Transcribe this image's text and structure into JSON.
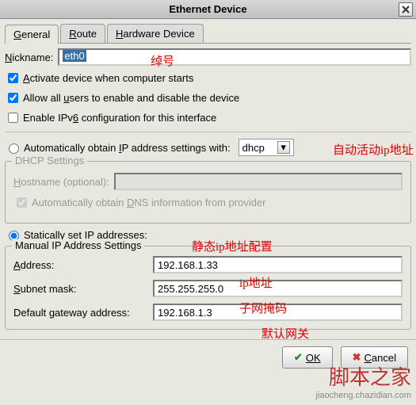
{
  "window": {
    "title": "Ethernet Device"
  },
  "tabs": {
    "general_u": "G",
    "general_rest": "eneral",
    "route_u": "R",
    "route_rest": "oute",
    "hw_u": "H",
    "hw_rest": "ardware Device"
  },
  "nickname": {
    "label_u": "N",
    "label_rest": "ickname:",
    "value": "eth0"
  },
  "checks": {
    "activate_pre": "",
    "activate_u": "A",
    "activate_rest": "ctivate device when computer starts",
    "users_pre": "Allow all ",
    "users_u": "u",
    "users_rest": "sers to enable and disable the device",
    "ipv6_pre": "Enable IPv",
    "ipv6_u": "6",
    "ipv6_rest": " configuration for this interface"
  },
  "auto": {
    "label_pre": "Automatically obtain ",
    "label_u": "I",
    "label_rest": "P address settings with:",
    "dd_value": "dhcp"
  },
  "dhcp": {
    "legend": "DHCP Settings",
    "hostname_pre": "",
    "hostname_u": "H",
    "hostname_rest": "ostname (optional):",
    "autodns_pre": "Automatically obtain ",
    "autodns_u": "D",
    "autodns_rest": "NS information from provider"
  },
  "static": {
    "label_pre": "",
    "label_u": "S",
    "label_rest": "tatically set IP addresses:",
    "legend": "Manual IP Address Settings",
    "addr_u": "A",
    "addr_rest": "ddress:",
    "addr_val": "192.168.1.33",
    "mask_u": "S",
    "mask_rest": "ubnet mask:",
    "mask_val": "255.255.255.0",
    "gw_pre": "Default ",
    "gw_u": "g",
    "gw_rest": "ateway address:",
    "gw_val": "192.168.1.3"
  },
  "footer": {
    "ok": "OK",
    "cancel": "Cancel"
  },
  "annotations": {
    "nickname": "绰号",
    "auto": "自动活动ip地址",
    "static": "静态ip地址配置",
    "addr": "ip地址",
    "mask": "子网掩码",
    "gw": "默认网关"
  },
  "watermark": {
    "big": "脚本之家",
    "small": "jiaocheng.chazidian.com"
  }
}
